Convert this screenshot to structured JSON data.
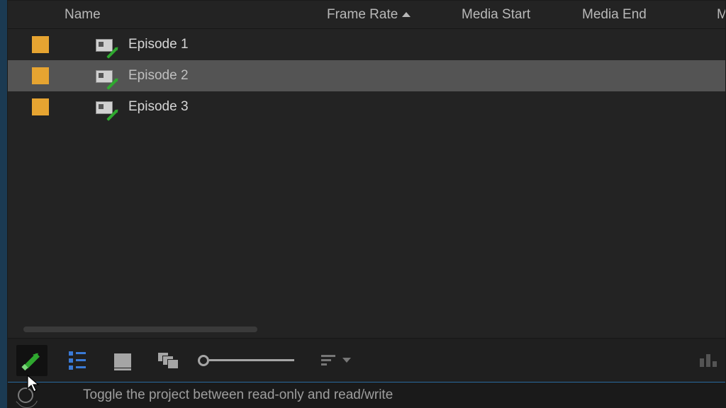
{
  "columns": {
    "name": "Name",
    "frame_rate": "Frame Rate",
    "media_start": "Media Start",
    "media_end": "Media End",
    "next_partial": "Me"
  },
  "rows": [
    {
      "name": "Episode 1",
      "selected": false
    },
    {
      "name": "Episode 2",
      "selected": true
    },
    {
      "name": "Episode 3",
      "selected": false
    }
  ],
  "status": {
    "tooltip": "Toggle the project between read-only and read/write"
  }
}
